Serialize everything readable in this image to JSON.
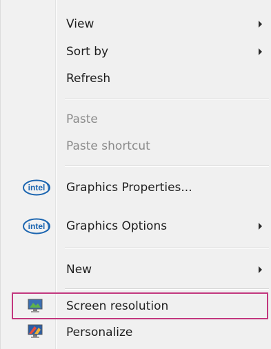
{
  "context_menu": {
    "items": [
      {
        "label": "View",
        "has_submenu": true,
        "enabled": true
      },
      {
        "label": "Sort by",
        "has_submenu": true,
        "enabled": true
      },
      {
        "label": "Refresh",
        "has_submenu": false,
        "enabled": true
      },
      {
        "label": "Paste",
        "has_submenu": false,
        "enabled": false
      },
      {
        "label": "Paste shortcut",
        "has_submenu": false,
        "enabled": false
      },
      {
        "label": "Graphics Properties...",
        "has_submenu": false,
        "enabled": true,
        "icon": "intel-logo-icon",
        "icon_text": "intel"
      },
      {
        "label": "Graphics Options",
        "has_submenu": true,
        "enabled": true,
        "icon": "intel-logo-icon",
        "icon_text": "intel"
      },
      {
        "label": "New",
        "has_submenu": true,
        "enabled": true
      },
      {
        "label": "Screen resolution",
        "has_submenu": false,
        "enabled": true,
        "icon": "monitor-icon",
        "highlighted": true
      },
      {
        "label": "Personalize",
        "has_submenu": false,
        "enabled": true,
        "icon": "personalize-monitor-icon"
      }
    ]
  },
  "colors": {
    "highlight_border": "#c2377e",
    "intel_blue": "#1b65b0"
  }
}
